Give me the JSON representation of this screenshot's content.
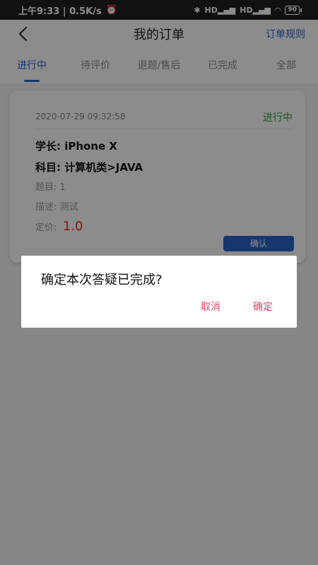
{
  "status_bar": {
    "left_text": "上午9:33 | 0.5K/s",
    "alarm_icon": "alarm-icon",
    "bluetooth_icon": "bluetooth-icon",
    "network1": "HD",
    "network2": "HD",
    "wifi_icon": "wifi-icon",
    "battery": "90"
  },
  "header": {
    "title": "我的订单",
    "right_link": "订单规则",
    "back_icon": "back-arrow-icon"
  },
  "tabs": [
    {
      "label": "进行中",
      "active": true
    },
    {
      "label": "待评价",
      "active": false
    },
    {
      "label": "退题/售后",
      "active": false
    },
    {
      "label": "已完成",
      "active": false
    },
    {
      "label": "全部",
      "active": false
    }
  ],
  "order": {
    "datetime": "2020-07-29 09:32:58",
    "status": "进行中",
    "senior": "学长: iPhone X",
    "subject": "科目: 计算机类>JAVA",
    "question": "题目: 1",
    "description": "描述: 测试",
    "price_label": "定价:",
    "price": "1.0",
    "confirm_button": "确认"
  },
  "dialog": {
    "message": "确定本次答疑已完成?",
    "cancel": "取消",
    "confirm": "确定"
  },
  "colors": {
    "accent": "#2b63c9",
    "status_green": "#2e9d3a",
    "price_red": "#e0322e",
    "dialog_action": "#e04568"
  }
}
